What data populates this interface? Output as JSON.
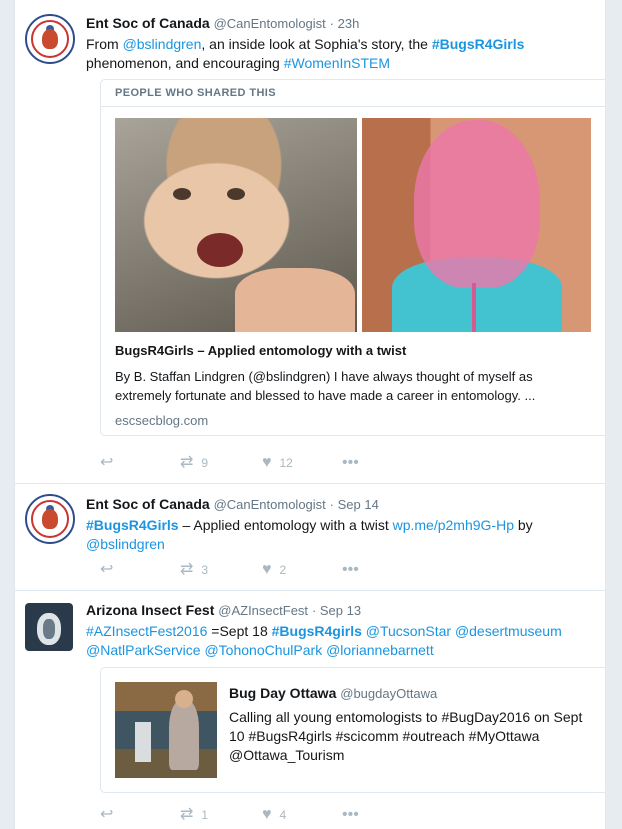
{
  "tweets": [
    {
      "name": "Ent Soc of Canada",
      "handle": "@CanEntomologist",
      "time": "· 23h",
      "text": {
        "t1": "From ",
        "mention1": "@bslindgren",
        "t2": ", an inside look at Sophia's story, the ",
        "hash1": "#BugsR4Girls",
        "t3": " phenomenon, and encouraging ",
        "hash2": "#WomenInSTEM"
      },
      "card": {
        "heading": "PEOPLE WHO SHARED THIS",
        "title": "BugsR4Girls – Applied entomology with a twist",
        "description": "By B. Staffan Lindgren (@bslindgren) I have always thought of myself as extremely fortunate and blessed to have made a career in entomology. ...",
        "domain": "escsecblog.com"
      },
      "retweets": "9",
      "likes": "12"
    },
    {
      "name": "Ent Soc of Canada",
      "handle": "@CanEntomologist",
      "time": "· Sep 14",
      "text": {
        "hash1": "#BugsR4Girls",
        "t1": " – Applied entomology with a twist ",
        "link": "wp.me/p2mh9G-Hp",
        "t2": " by ",
        "mention1": "@bslindgren"
      },
      "retweets": "3",
      "likes": "2"
    },
    {
      "name": "Arizona Insect Fest",
      "handle": "@AZInsectFest",
      "time": "· Sep 13",
      "text": {
        "hash1": "#AZInsectFest2016",
        "t1": " =Sept 18 ",
        "hash2": "#BugsR4girls",
        "t2": " ",
        "mention1": "@TucsonStar",
        "t3": " ",
        "mention2": "@desertmuseum",
        "t4": " ",
        "mention3": "@NatlParkService",
        "t5": " ",
        "mention4": "@TohonoChulPark",
        "t6": " ",
        "mention5": "@loriannebarnett"
      },
      "quote": {
        "name": "Bug Day Ottawa",
        "handle": "@bugdayOttawa",
        "text": "Calling all young entomologists to #BugDay2016 on Sept 10 #BugsR4girls #scicomm #outreach  #MyOttawa @Ottawa_Tourism"
      },
      "retweets": "1",
      "likes": "4"
    }
  ],
  "icons": {
    "reply": "reply-icon",
    "retweet": "retweet-icon",
    "like": "heart-icon",
    "more": "more-icon"
  },
  "colors": {
    "link": "#1b95e0",
    "meta": "#657786",
    "action": "#aab8c2"
  }
}
